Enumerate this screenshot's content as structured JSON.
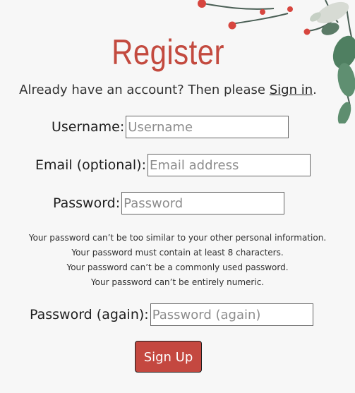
{
  "page": {
    "title": "Register",
    "subtitle_prefix": "Already have an account? Then please ",
    "signin_link": "Sign in",
    "subtitle_suffix": "."
  },
  "form": {
    "username": {
      "label": "Username:",
      "placeholder": "Username"
    },
    "email": {
      "label": "Email (optional):",
      "placeholder": "Email address"
    },
    "password": {
      "label": "Password:",
      "placeholder": "Password"
    },
    "password_again": {
      "label": "Password (again):",
      "placeholder": "Password (again)"
    },
    "help": [
      "Your password can’t be too similar to your other personal information.",
      "Your password must contain at least 8 characters.",
      "Your password can’t be a commonly used password.",
      "Your password can’t be entirely numeric."
    ],
    "submit_label": "Sign Up"
  },
  "decor": {
    "icon": "floral-branch-icon",
    "accent": "#c44840"
  }
}
